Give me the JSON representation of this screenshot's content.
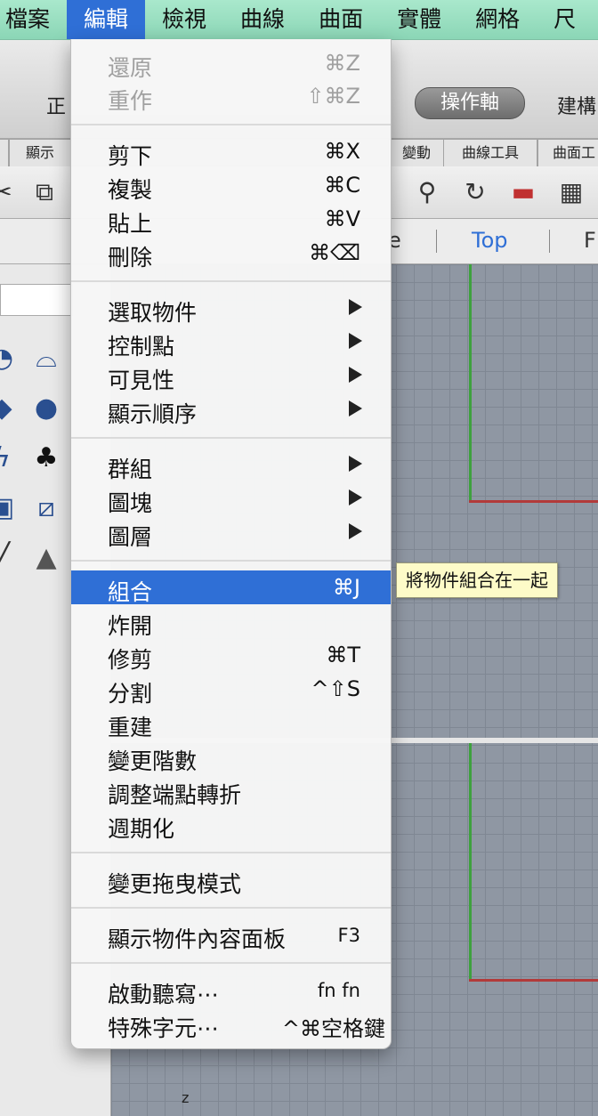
{
  "menubar": {
    "items": [
      "檔案",
      "編輯",
      "檢視",
      "曲線",
      "曲面",
      "實體",
      "網格",
      "尺"
    ]
  },
  "toolbar": {
    "left_label": "正",
    "axis_button": "操作軸",
    "build_label": "建構",
    "tabs": [
      "顯示",
      "變動",
      "曲線工具",
      "曲面工"
    ]
  },
  "viewports": {
    "labels": [
      "e",
      "Top",
      "F"
    ],
    "z_label": "z"
  },
  "edit_menu": {
    "group_undo": [
      {
        "label": "還原",
        "shortcut": "⌘Z"
      },
      {
        "label": "重作",
        "shortcut": "⇧⌘Z"
      }
    ],
    "group_clip": [
      {
        "label": "剪下",
        "shortcut": "⌘X"
      },
      {
        "label": "複製",
        "shortcut": "⌘C"
      },
      {
        "label": "貼上",
        "shortcut": "⌘V"
      },
      {
        "label": "刪除",
        "shortcut": "⌘⌫"
      }
    ],
    "group_sel": [
      {
        "label": "選取物件"
      },
      {
        "label": "控制點"
      },
      {
        "label": "可見性"
      },
      {
        "label": "顯示順序"
      }
    ],
    "group_grp": [
      {
        "label": "群組"
      },
      {
        "label": "圖塊"
      },
      {
        "label": "圖層"
      }
    ],
    "group_ops": [
      {
        "label": "組合",
        "shortcut": "⌘J"
      },
      {
        "label": "炸開",
        "shortcut": ""
      },
      {
        "label": "修剪",
        "shortcut": "⌘T"
      },
      {
        "label": "分割",
        "shortcut": "^⇧S"
      },
      {
        "label": "重建",
        "shortcut": ""
      },
      {
        "label": "變更階數",
        "shortcut": ""
      },
      {
        "label": "調整端點轉折",
        "shortcut": ""
      },
      {
        "label": "週期化",
        "shortcut": ""
      }
    ],
    "drag_mode": {
      "label": "變更拖曳模式"
    },
    "properties": {
      "label": "顯示物件內容面板",
      "shortcut": "F3"
    },
    "dictation": {
      "label": "啟動聽寫⋯",
      "shortcut": "fn fn"
    },
    "special_chars": {
      "label": "特殊字元⋯",
      "shortcut": "^⌘空格鍵"
    }
  },
  "tooltip": {
    "text": "將物件組合在一起"
  },
  "colors": {
    "highlight": "#2f6fd6",
    "menubar": "#9fe0c4",
    "x_axis": "#b23a3a",
    "y_axis": "#3ea13e"
  }
}
